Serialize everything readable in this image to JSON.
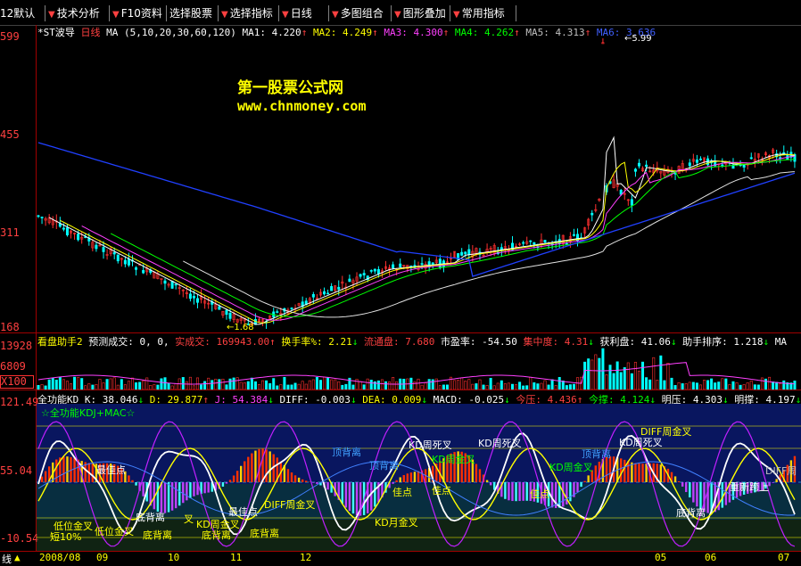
{
  "menu": {
    "items": [
      {
        "label": "12默认"
      },
      {
        "label": "技术分析"
      },
      {
        "label": "F10资料"
      },
      {
        "label": "选择股票"
      },
      {
        "label": "选择指标"
      },
      {
        "label": "日线"
      },
      {
        "label": "多图组合"
      },
      {
        "label": "图形叠加"
      },
      {
        "label": "常用指标"
      }
    ]
  },
  "price_panel": {
    "stock_name": "*ST波导",
    "period": "日线",
    "ma_params": "MA (5,10,20,30,60,120)",
    "ma1": "MA1: 4.220",
    "ma2": "MA2: 4.249",
    "ma3": "MA3: 4.300",
    "ma4": "MA4: 4.262",
    "ma5": "MA5: 4.313",
    "ma6": "MA6: 3.636",
    "axis": [
      "599",
      "455",
      "311",
      "168"
    ],
    "high_label": "5.99",
    "low_label": "1.68",
    "watermark_title": "第一股票公式网",
    "watermark_url": "www.chnmoney.com",
    "colors": {
      "up": "#ff3030",
      "ma_white": "#ffffff",
      "ma_yellow": "#ffff00",
      "ma_magenta": "#ff40ff",
      "ma_green": "#00ff00",
      "ma_blue": "#2040ff"
    }
  },
  "volume_panel": {
    "title": "看盘助手2",
    "forecast": "预测成交: 0, 0,",
    "actual": "实成交: 169943.00",
    "turnover": "换手率%: 2.21",
    "float": "流通盘: 7.680",
    "pe": "市盈率: -54.50",
    "concentration": "集中度: 4.31",
    "profit": "获利盘: 41.06",
    "rank": "助手排序: 1.218",
    "ma_tail": "MA",
    "axis": [
      "13928",
      "6809",
      "X100"
    ]
  },
  "kdj_panel": {
    "title": "全功能KD",
    "k": "K: 38.046",
    "d": "D: 29.877",
    "j": "J: 54.384",
    "diff": "DIFF: -0.003",
    "dea": "DEA: 0.009",
    "macd": "MACD: -0.025",
    "today_press": "今压: 4.436",
    "today_support": "今撑: 4.124",
    "tomorrow_press": "明压: 4.303",
    "tomorrow_support": "明撑: 4.197",
    "subtitle": "☆全功能KDJ+MAC☆",
    "axis": [
      "121.49",
      "55.04",
      "-10.54"
    ],
    "annotations": [
      "最佳点",
      "底背离",
      "短10%",
      "低位金叉",
      "低位金叉",
      "最佳点",
      "底背离",
      "叉",
      "KD周金叉",
      "底背离",
      "底背离",
      "DIFF周金叉",
      "顶背离",
      "顶背离",
      "佳点",
      "佳点",
      "KD周死叉",
      "KD周死叉",
      "KD周金叉",
      "佳点",
      "KD月金叉",
      "顶背离",
      "KD周死叉",
      "DIFF周金叉",
      "KD周金叉",
      "底背离",
      "重新跨上",
      "DIFF周"
    ]
  },
  "timebar": {
    "left": "线",
    "labels": [
      "2008/08",
      "09",
      "10",
      "11",
      "12",
      "05",
      "06",
      "07"
    ]
  }
}
